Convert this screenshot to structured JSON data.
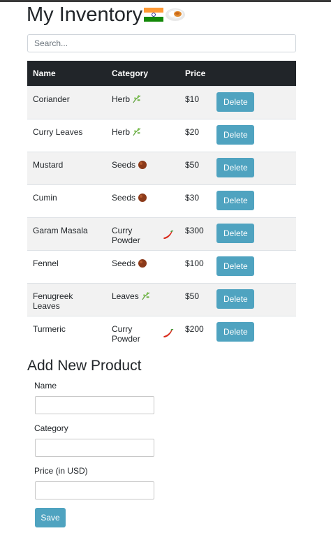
{
  "page": {
    "title": "My Inventory",
    "title_icons": [
      "india-flag-icon",
      "curry-bowl-icon"
    ]
  },
  "search": {
    "placeholder": "Search..."
  },
  "table": {
    "headers": {
      "name": "Name",
      "category": "Category",
      "price": "Price"
    },
    "rows": [
      {
        "name": "Coriander",
        "category": "Herb",
        "icon": "herb-icon",
        "price": "$10",
        "action": "Delete"
      },
      {
        "name": "Curry Leaves",
        "category": "Herb",
        "icon": "herb-icon",
        "price": "$20",
        "action": "Delete"
      },
      {
        "name": "Mustard",
        "category": "Seeds",
        "icon": "coconut-icon",
        "price": "$50",
        "action": "Delete"
      },
      {
        "name": "Cumin",
        "category": "Seeds",
        "icon": "coconut-icon",
        "price": "$30",
        "action": "Delete"
      },
      {
        "name": "Garam Masala",
        "category": "Curry Powder",
        "icon": "chili-pepper-icon",
        "price": "$300",
        "action": "Delete"
      },
      {
        "name": "Fennel",
        "category": "Seeds",
        "icon": "coconut-icon",
        "price": "$100",
        "action": "Delete"
      },
      {
        "name": "Fenugreek Leaves",
        "category": "Leaves",
        "icon": "herb-icon",
        "price": "$50",
        "action": "Delete"
      },
      {
        "name": "Turmeric",
        "category": "Curry Powder",
        "icon": "chili-pepper-icon",
        "price": "$200",
        "action": "Delete"
      }
    ]
  },
  "form": {
    "title": "Add New Product",
    "name_label": "Name",
    "name_value": "",
    "category_label": "Category",
    "category_value": "",
    "price_label": "Price (in USD)",
    "price_value": "",
    "save_label": "Save"
  },
  "colors": {
    "header_bg": "#212529",
    "button_bg": "#4fa3c0",
    "stripe_bg": "#f2f2f2"
  }
}
